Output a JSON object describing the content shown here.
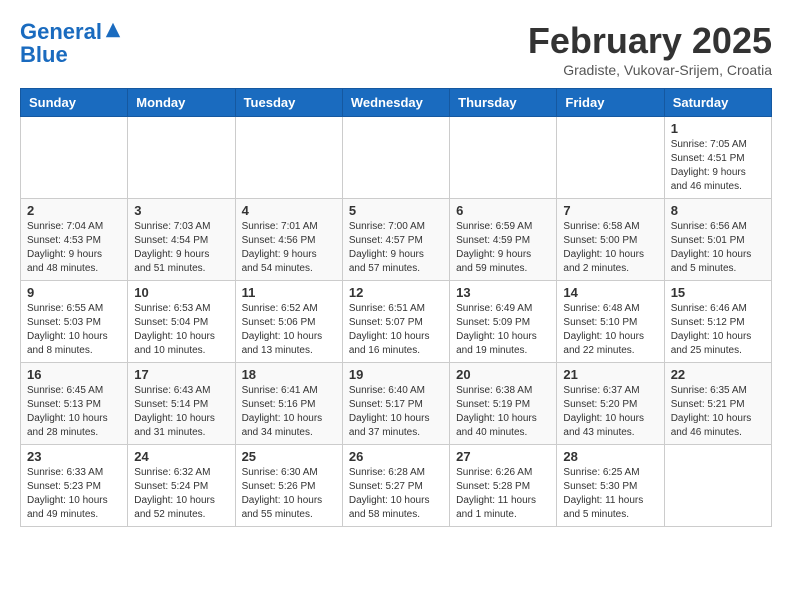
{
  "logo": {
    "line1": "General",
    "line2": "Blue"
  },
  "title": "February 2025",
  "location": "Gradiste, Vukovar-Srijem, Croatia",
  "headers": [
    "Sunday",
    "Monday",
    "Tuesday",
    "Wednesday",
    "Thursday",
    "Friday",
    "Saturday"
  ],
  "weeks": [
    [
      {
        "day": "",
        "info": ""
      },
      {
        "day": "",
        "info": ""
      },
      {
        "day": "",
        "info": ""
      },
      {
        "day": "",
        "info": ""
      },
      {
        "day": "",
        "info": ""
      },
      {
        "day": "",
        "info": ""
      },
      {
        "day": "1",
        "info": "Sunrise: 7:05 AM\nSunset: 4:51 PM\nDaylight: 9 hours\nand 46 minutes."
      }
    ],
    [
      {
        "day": "2",
        "info": "Sunrise: 7:04 AM\nSunset: 4:53 PM\nDaylight: 9 hours\nand 48 minutes."
      },
      {
        "day": "3",
        "info": "Sunrise: 7:03 AM\nSunset: 4:54 PM\nDaylight: 9 hours\nand 51 minutes."
      },
      {
        "day": "4",
        "info": "Sunrise: 7:01 AM\nSunset: 4:56 PM\nDaylight: 9 hours\nand 54 minutes."
      },
      {
        "day": "5",
        "info": "Sunrise: 7:00 AM\nSunset: 4:57 PM\nDaylight: 9 hours\nand 57 minutes."
      },
      {
        "day": "6",
        "info": "Sunrise: 6:59 AM\nSunset: 4:59 PM\nDaylight: 9 hours\nand 59 minutes."
      },
      {
        "day": "7",
        "info": "Sunrise: 6:58 AM\nSunset: 5:00 PM\nDaylight: 10 hours\nand 2 minutes."
      },
      {
        "day": "8",
        "info": "Sunrise: 6:56 AM\nSunset: 5:01 PM\nDaylight: 10 hours\nand 5 minutes."
      }
    ],
    [
      {
        "day": "9",
        "info": "Sunrise: 6:55 AM\nSunset: 5:03 PM\nDaylight: 10 hours\nand 8 minutes."
      },
      {
        "day": "10",
        "info": "Sunrise: 6:53 AM\nSunset: 5:04 PM\nDaylight: 10 hours\nand 10 minutes."
      },
      {
        "day": "11",
        "info": "Sunrise: 6:52 AM\nSunset: 5:06 PM\nDaylight: 10 hours\nand 13 minutes."
      },
      {
        "day": "12",
        "info": "Sunrise: 6:51 AM\nSunset: 5:07 PM\nDaylight: 10 hours\nand 16 minutes."
      },
      {
        "day": "13",
        "info": "Sunrise: 6:49 AM\nSunset: 5:09 PM\nDaylight: 10 hours\nand 19 minutes."
      },
      {
        "day": "14",
        "info": "Sunrise: 6:48 AM\nSunset: 5:10 PM\nDaylight: 10 hours\nand 22 minutes."
      },
      {
        "day": "15",
        "info": "Sunrise: 6:46 AM\nSunset: 5:12 PM\nDaylight: 10 hours\nand 25 minutes."
      }
    ],
    [
      {
        "day": "16",
        "info": "Sunrise: 6:45 AM\nSunset: 5:13 PM\nDaylight: 10 hours\nand 28 minutes."
      },
      {
        "day": "17",
        "info": "Sunrise: 6:43 AM\nSunset: 5:14 PM\nDaylight: 10 hours\nand 31 minutes."
      },
      {
        "day": "18",
        "info": "Sunrise: 6:41 AM\nSunset: 5:16 PM\nDaylight: 10 hours\nand 34 minutes."
      },
      {
        "day": "19",
        "info": "Sunrise: 6:40 AM\nSunset: 5:17 PM\nDaylight: 10 hours\nand 37 minutes."
      },
      {
        "day": "20",
        "info": "Sunrise: 6:38 AM\nSunset: 5:19 PM\nDaylight: 10 hours\nand 40 minutes."
      },
      {
        "day": "21",
        "info": "Sunrise: 6:37 AM\nSunset: 5:20 PM\nDaylight: 10 hours\nand 43 minutes."
      },
      {
        "day": "22",
        "info": "Sunrise: 6:35 AM\nSunset: 5:21 PM\nDaylight: 10 hours\nand 46 minutes."
      }
    ],
    [
      {
        "day": "23",
        "info": "Sunrise: 6:33 AM\nSunset: 5:23 PM\nDaylight: 10 hours\nand 49 minutes."
      },
      {
        "day": "24",
        "info": "Sunrise: 6:32 AM\nSunset: 5:24 PM\nDaylight: 10 hours\nand 52 minutes."
      },
      {
        "day": "25",
        "info": "Sunrise: 6:30 AM\nSunset: 5:26 PM\nDaylight: 10 hours\nand 55 minutes."
      },
      {
        "day": "26",
        "info": "Sunrise: 6:28 AM\nSunset: 5:27 PM\nDaylight: 10 hours\nand 58 minutes."
      },
      {
        "day": "27",
        "info": "Sunrise: 6:26 AM\nSunset: 5:28 PM\nDaylight: 11 hours\nand 1 minute."
      },
      {
        "day": "28",
        "info": "Sunrise: 6:25 AM\nSunset: 5:30 PM\nDaylight: 11 hours\nand 5 minutes."
      },
      {
        "day": "",
        "info": ""
      }
    ]
  ]
}
